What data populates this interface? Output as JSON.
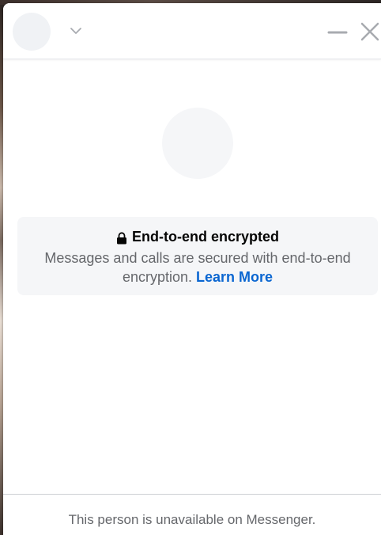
{
  "header": {
    "avatar": "avatar-placeholder",
    "chevron_icon": "chevron-down-icon",
    "minimize_icon": "minimize-icon",
    "close_icon": "close-icon"
  },
  "profile": {
    "avatar": "avatar-placeholder"
  },
  "encryption_notice": {
    "icon": "lock-icon",
    "title": "End-to-end encrypted",
    "description": "Messages and calls are secured with end-to-end encryption.",
    "link_label": "Learn More"
  },
  "footer": {
    "status_text": "This person is unavailable on Messenger."
  },
  "colors": {
    "link": "#0a66d1",
    "card_bg": "#f5f6f8",
    "secondary_text": "#65676b",
    "primary_text": "#050505"
  }
}
